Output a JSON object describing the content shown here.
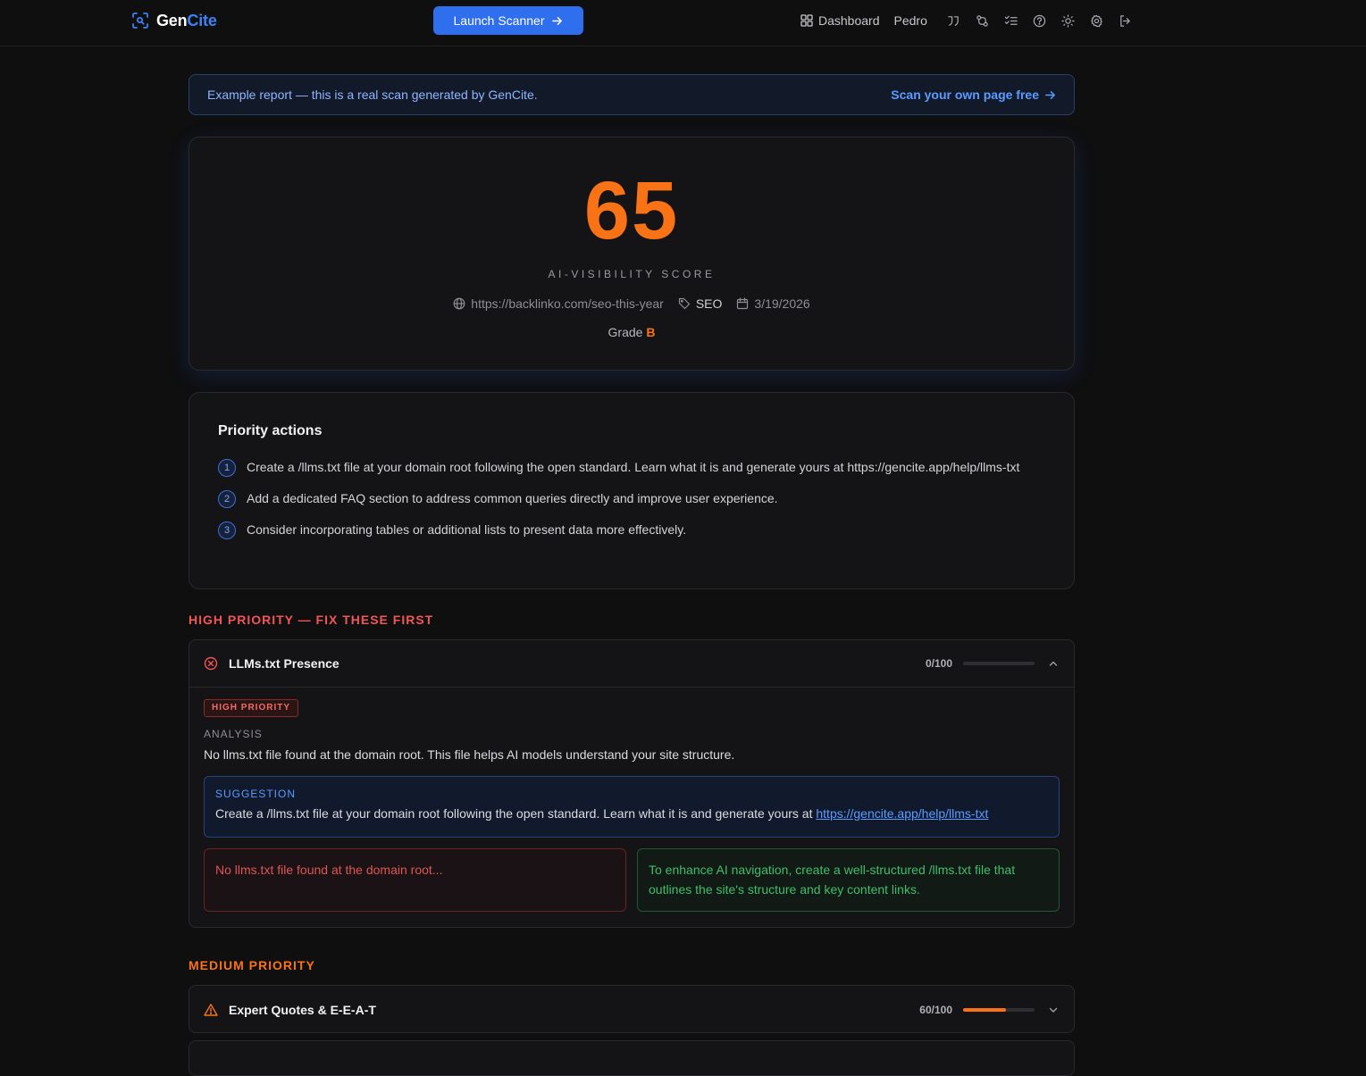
{
  "brand": {
    "part1": "Gen",
    "part2": "Cite"
  },
  "header": {
    "launch_label": "Launch Scanner",
    "dashboard_label": "Dashboard",
    "user_name": "Pedro",
    "icons": [
      "quote-icon",
      "git-compare-icon",
      "list-checks-icon",
      "help-circle-icon",
      "sun-icon",
      "settings-icon",
      "log-out-icon"
    ]
  },
  "banner": {
    "message": "Example report — this is a real scan generated by GenCite.",
    "cta": "Scan your own page free"
  },
  "score": {
    "value": "65",
    "label": "AI-VISIBILITY SCORE",
    "url": "https://backlinko.com/seo-this-year",
    "tag": "SEO",
    "date": "3/19/2026",
    "grade_label": "Grade",
    "grade": "B",
    "color": "#f97316"
  },
  "priority_actions": {
    "title": "Priority actions",
    "items": [
      {
        "num": "1",
        "text": "Create a /llms.txt file at your domain root following the open standard. Learn what it is and generate yours at https://gencite.app/help/llms-txt"
      },
      {
        "num": "2",
        "text": "Add a dedicated FAQ section to address common queries directly and improve user experience."
      },
      {
        "num": "3",
        "text": "Consider incorporating tables or additional lists to present data more effectively."
      }
    ]
  },
  "sections": {
    "high": "HIGH PRIORITY — FIX THESE FIRST",
    "medium": "MEDIUM PRIORITY"
  },
  "checks": {
    "high": {
      "title": "LLMs.txt Presence",
      "score_text": "0/100",
      "score": 0,
      "badge": "HIGH PRIORITY",
      "analysis_label": "ANALYSIS",
      "analysis": "No llms.txt file found at the domain root. This file helps AI models understand your site structure.",
      "suggestion_label": "SUGGESTION",
      "suggestion_text": "Create a /llms.txt file at your domain root following the open standard. Learn what it is and generate yours at ",
      "suggestion_link": "https://gencite.app/help/llms-txt",
      "before": "No llms.txt file found at the domain root...",
      "after": "To enhance AI navigation, create a well-structured /llms.txt file that outlines the site's structure and key content links."
    },
    "medium": {
      "title": "Expert Quotes & E-E-A-T",
      "score_text": "60/100",
      "score": 60
    }
  },
  "colors": {
    "accent": "#2f6fed",
    "high": "#f25555",
    "medium": "#f97316",
    "good": "#3fbf6a"
  }
}
